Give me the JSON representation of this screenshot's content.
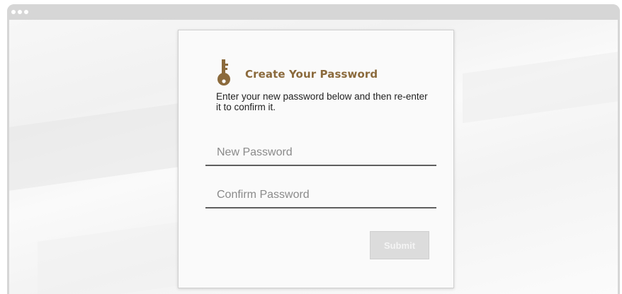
{
  "form": {
    "title": "Create Your Password",
    "description": "Enter your new password below and then re-enter it to confirm it.",
    "new_password": {
      "placeholder": "New Password",
      "value": ""
    },
    "confirm_password": {
      "placeholder": "Confirm Password",
      "value": ""
    },
    "submit_label": "Submit",
    "submit_enabled": false
  },
  "colors": {
    "accent": "#8b6a3c",
    "icon": "#8b6a3c",
    "submit_disabled_bg": "#dcdcdc",
    "window_chrome": "#d6d6d6"
  },
  "icons": {
    "header": "key-icon"
  }
}
